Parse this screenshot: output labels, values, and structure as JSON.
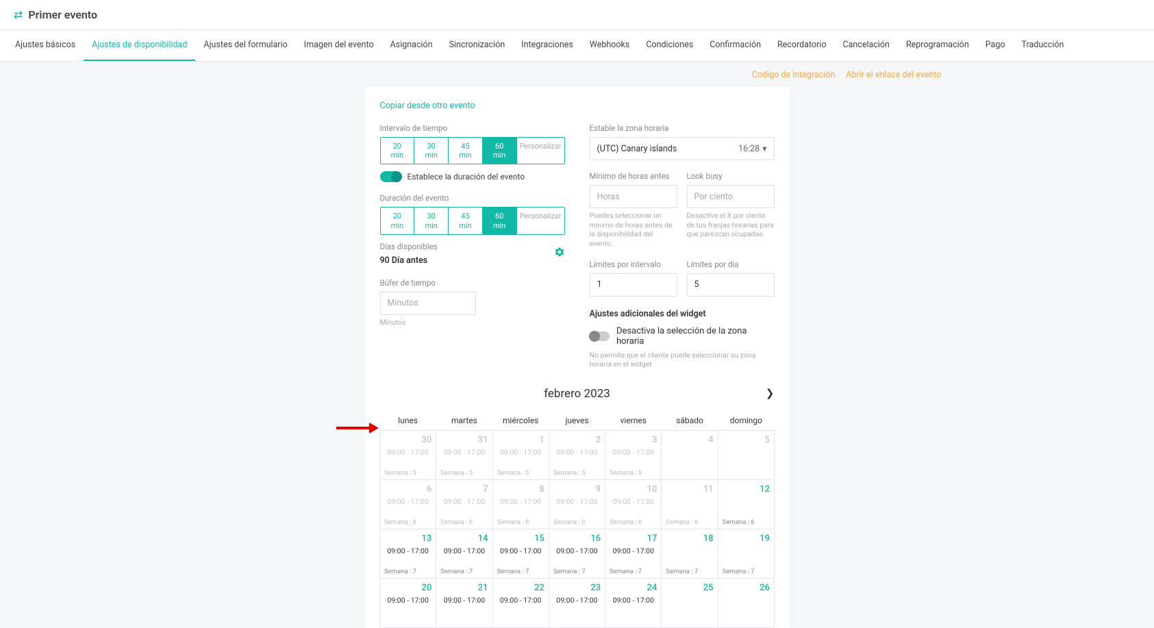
{
  "header": {
    "title": "Primer evento"
  },
  "tabs": [
    "Ajustes básicos",
    "Ajustes de disponibilidad",
    "Ajustes del formulario",
    "Imagen del evento",
    "Asignación",
    "Sincronización",
    "Integraciones",
    "Webhooks",
    "Condiciones",
    "Confirmación",
    "Recordatorio",
    "Cancelación",
    "Reprogramación",
    "Pago",
    "Traducción"
  ],
  "active_tab_index": 1,
  "links": {
    "code": "Codigo de integración",
    "open": "Abrir el enlace del evento"
  },
  "copy_from": "Copiar desde otro evento",
  "interval": {
    "label": "Intervalo de tiempo",
    "options": [
      "20\nmin",
      "30\nmin",
      "45\nmin",
      "60\nmin",
      "Personalizar"
    ],
    "selected_index": 3
  },
  "sets_duration": "Establece la duración del evento",
  "duration": {
    "label": "Duración del evento",
    "options": [
      "20\nmin",
      "30\nmin",
      "45\nmin",
      "60\nmin",
      "Personalizar"
    ],
    "selected_index": 3
  },
  "available_days": {
    "label": "Días disponibles",
    "value": "90 Día antes"
  },
  "buffer": {
    "label": "Búfer de tiempo",
    "placeholder": "Minutos",
    "help": "Minutos"
  },
  "tz": {
    "label": "Estable la zona horaria",
    "value": "(UTC) Canary islands",
    "time": "16:28"
  },
  "min_hours": {
    "label": "Mínimo de horas antes",
    "placeholder": "Horas",
    "help": "Puedes seleccionar un mínimo de horas antes de la disponibilidad del evento."
  },
  "look_busy": {
    "label": "Look busy",
    "placeholder": "Por ciento",
    "help": "Desactiva el X por ciento de tus franjas horarias para que parezcan ocupadas"
  },
  "limit_interval": {
    "label": "Límites por intervalo",
    "value": "1"
  },
  "limit_day": {
    "label": "Límites por día",
    "value": "5"
  },
  "widget": {
    "title": "Ajustes adicionales del widget",
    "disable_tz": "Desactiva la selección de la zona horaria",
    "help": "No permite que el cliente puede seleccionar su zona horaria en el widget"
  },
  "cal": {
    "month": "febrero 2023",
    "days": [
      "lunes",
      "martes",
      "miércoles",
      "jueves",
      "viernes",
      "sábado",
      "domingo"
    ],
    "cells": [
      {
        "n": "30",
        "h": "09:00 - 17:00",
        "w": "Semana : 5",
        "state": "past"
      },
      {
        "n": "31",
        "h": "09:00 - 17:00",
        "w": "Semana : 5",
        "state": "past"
      },
      {
        "n": "1",
        "h": "09:00 - 17:00",
        "w": "Semana : 5",
        "state": "past"
      },
      {
        "n": "2",
        "h": "09:00 - 17:00",
        "w": "Semana : 5",
        "state": "past"
      },
      {
        "n": "3",
        "h": "09:00 - 17:00",
        "w": "Semana : 5",
        "state": "past"
      },
      {
        "n": "4",
        "h": "",
        "w": "",
        "state": "past"
      },
      {
        "n": "5",
        "h": "",
        "w": "",
        "state": "past"
      },
      {
        "n": "6",
        "h": "09:00 - 17:00",
        "w": "Semana : 6",
        "state": "past"
      },
      {
        "n": "7",
        "h": "09:00 - 17:00",
        "w": "Semana : 6",
        "state": "past"
      },
      {
        "n": "8",
        "h": "09:00 - 17:00",
        "w": "Semana : 6",
        "state": "past"
      },
      {
        "n": "9",
        "h": "09:00 - 17:00",
        "w": "Semana : 6",
        "state": "past"
      },
      {
        "n": "10",
        "h": "09:00 - 17:00",
        "w": "Semana : 6",
        "state": "past"
      },
      {
        "n": "11",
        "h": "",
        "w": "Semana : 6",
        "state": "past"
      },
      {
        "n": "12",
        "h": "",
        "w": "Semana : 6",
        "state": "future"
      },
      {
        "n": "13",
        "h": "09:00 - 17:00",
        "w": "Semana : 7",
        "state": "future"
      },
      {
        "n": "14",
        "h": "09:00 - 17:00",
        "w": "Semana : 7",
        "state": "future"
      },
      {
        "n": "15",
        "h": "09:00 - 17:00",
        "w": "Semana : 7",
        "state": "future"
      },
      {
        "n": "16",
        "h": "09:00 - 17:00",
        "w": "Semana : 7",
        "state": "future"
      },
      {
        "n": "17",
        "h": "09:00 - 17:00",
        "w": "Semana : 7",
        "state": "future"
      },
      {
        "n": "18",
        "h": "",
        "w": "Semana : 7",
        "state": "future"
      },
      {
        "n": "19",
        "h": "",
        "w": "Semana : 7",
        "state": "future"
      },
      {
        "n": "20",
        "h": "09:00 - 17:00",
        "w": "",
        "state": "future"
      },
      {
        "n": "21",
        "h": "09:00 - 17:00",
        "w": "",
        "state": "future"
      },
      {
        "n": "22",
        "h": "09:00 - 17:00",
        "w": "",
        "state": "future"
      },
      {
        "n": "23",
        "h": "09:00 - 17:00",
        "w": "",
        "state": "future"
      },
      {
        "n": "24",
        "h": "09:00 - 17:00",
        "w": "",
        "state": "future"
      },
      {
        "n": "25",
        "h": "",
        "w": "",
        "state": "future"
      },
      {
        "n": "26",
        "h": "",
        "w": "",
        "state": "future"
      }
    ]
  }
}
